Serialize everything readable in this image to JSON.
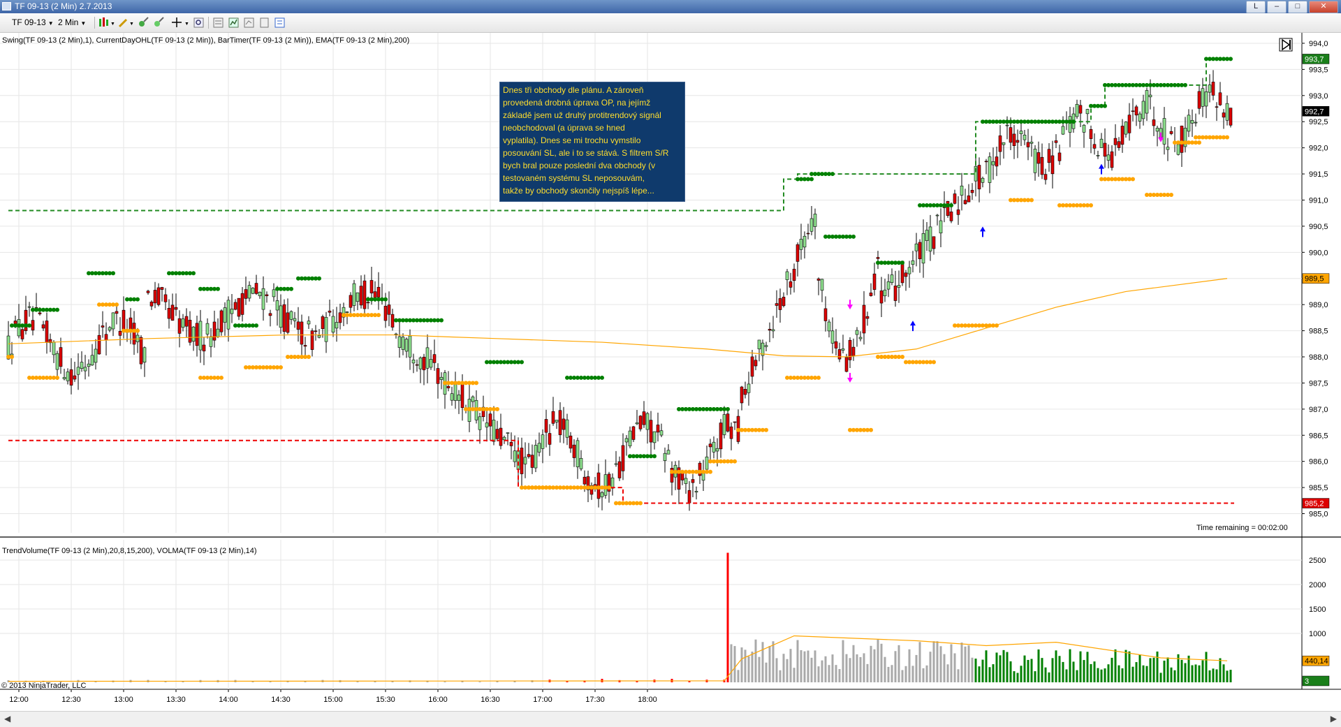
{
  "window": {
    "title": "TF 09-13 (2 Min)  2.7.2013",
    "buttons": {
      "l": "L",
      "minimize": "–",
      "maximize": "□",
      "close": "✕"
    }
  },
  "toolbar": {
    "instrument": "TF 09-13",
    "interval": "2 Min",
    "icons": [
      "bar-type-icon",
      "pencil-icon",
      "magic-icon",
      "crosshair-icon",
      "zoom-icon",
      "properties-icon",
      "indicators-icon",
      "strategy-icon",
      "data-box-icon",
      "text-icon"
    ]
  },
  "indicators_label": "Swing(TF 09-13 (2 Min),1), CurrentDayOHL(TF 09-13 (2 Min)), BarTimer(TF 09-13 (2 Min)), EMA(TF 09-13 (2 Min),200)",
  "volume_label": "TrendVolume(TF 09-13 (2 Min),20,8,15,200), VOLMA(TF 09-13 (2 Min),14)",
  "annotation_lines": [
    "Dnes tři obchody dle plánu. A zároveň",
    "provedená drobná úprava OP, na jejímž",
    "základě jsem už druhý protitrendový signál",
    "neobchodoval  (a úprava se hned",
    "vyplatila). Dnes se mi trochu vymstilo",
    "posouvání SL, ale i to se stává. S filtrem S/R",
    "bych bral pouze poslední dva obchody (v",
    "testovaném systému SL neposouvám,",
    "takže by obchody skončily nejspíš lépe..."
  ],
  "time_remaining": "Time remaining = 00:02:00",
  "copyright": "© 2013 NinjaTrader, LLC",
  "price_markers": {
    "high": "993,7",
    "last": "992,7",
    "ema": "989,5",
    "low": "985,2",
    "volma": "440,14",
    "volume_last": "3"
  },
  "colors": {
    "up_candle": "#8ee08e",
    "down_candle": "#dd0000",
    "swing_high": "#008000",
    "swing_low": "#ffa500",
    "ema": "#ffa500",
    "day_high": "#228b22",
    "day_low": "#ee0000",
    "volume_up": "#008000",
    "volume_down": "#ff0000",
    "volume_neutral": "#a9a9a9"
  },
  "chart_data": [
    {
      "type": "candlestick",
      "interval": "2 Min",
      "x_ticks": [
        "12:00",
        "12:30",
        "13:00",
        "13:30",
        "14:00",
        "14:30",
        "15:00",
        "15:30",
        "16:00",
        "16:30",
        "17:00",
        "17:30",
        "18:00"
      ],
      "y_ticks": [
        "985,0",
        "985,5",
        "986,0",
        "986,5",
        "987,0",
        "987,5",
        "988,0",
        "988,5",
        "989,0",
        "989,5",
        "990,0",
        "990,5",
        "991,0",
        "991,5",
        "992,0",
        "992,5",
        "993,0",
        "993,5",
        "994,0"
      ],
      "ylim": [
        984.9,
        994.2
      ],
      "grid": true,
      "start_time": "11:54",
      "series": [
        {
          "name": "Swing high",
          "style": "dots",
          "segments": [
            [
              1,
              6,
              988.6
            ],
            [
              7,
              14,
              988.9
            ],
            [
              23,
              30,
              989.6
            ],
            [
              34,
              37,
              989.1
            ],
            [
              46,
              53,
              989.6
            ],
            [
              55,
              60,
              989.3
            ],
            [
              65,
              71,
              988.6
            ],
            [
              77,
              81,
              989.3
            ],
            [
              83,
              89,
              989.5
            ],
            [
              103,
              108,
              989.1
            ],
            [
              111,
              124,
              988.7
            ],
            [
              137,
              147,
              987.9
            ],
            [
              160,
              170,
              987.6
            ],
            [
              178,
              185,
              986.1
            ],
            [
              192,
              206,
              987.0
            ],
            [
              226,
              230,
              991.4
            ],
            [
              230,
              236,
              991.5
            ],
            [
              234,
              242,
              990.3
            ],
            [
              249,
              256,
              989.8
            ],
            [
              261,
              270,
              990.9
            ],
            [
              279,
              286,
              992.5
            ],
            [
              286,
              305,
              992.5
            ],
            [
              310,
              314,
              992.8
            ],
            [
              314,
              337,
              993.2
            ],
            [
              343,
              350,
              993.7
            ]
          ]
        },
        {
          "name": "Swing low",
          "style": "dots",
          "segments": [
            [
              0,
              1,
              988.0
            ],
            [
              6,
              14,
              987.6
            ],
            [
              26,
              31,
              989.0
            ],
            [
              33,
              37,
              988.5
            ],
            [
              55,
              61,
              987.6
            ],
            [
              68,
              78,
              987.8
            ],
            [
              80,
              86,
              988.0
            ],
            [
              96,
              106,
              988.8
            ],
            [
              125,
              134,
              987.5
            ],
            [
              131,
              140,
              987.0
            ],
            [
              147,
              155,
              985.5
            ],
            [
              149,
              172,
              985.5
            ],
            [
              174,
              181,
              985.2
            ],
            [
              190,
              201,
              985.8
            ],
            [
              201,
              208,
              986.0
            ],
            [
              209,
              217,
              986.6
            ],
            [
              223,
              232,
              987.6
            ],
            [
              241,
              247,
              986.6
            ],
            [
              249,
              256,
              988.0
            ],
            [
              257,
              265,
              987.9
            ],
            [
              271,
              283,
              988.6
            ],
            [
              287,
              293,
              991.0
            ],
            [
              301,
              310,
              990.9
            ],
            [
              313,
              322,
              991.4
            ],
            [
              326,
              333,
              991.1
            ],
            [
              334,
              341,
              992.1
            ],
            [
              340,
              349,
              992.2
            ]
          ]
        },
        {
          "name": "Current day high",
          "style": "dashed",
          "steps": [
            [
              0,
              990.8
            ],
            [
              222,
              991.4
            ],
            [
              226,
              991.5
            ],
            [
              277,
              992.5
            ],
            [
              310,
              992.8
            ],
            [
              314,
              993.2
            ],
            [
              343,
              993.7
            ],
            [
              350,
              993.7
            ]
          ]
        },
        {
          "name": "Current day low",
          "style": "dashed",
          "steps": [
            [
              0,
              986.4
            ],
            [
              146,
              985.5
            ],
            [
              176,
              985.2
            ],
            [
              351,
              985.2
            ]
          ]
        },
        {
          "name": "EMA 200",
          "points": [
            [
              0,
              988.25
            ],
            [
              40,
              988.35
            ],
            [
              80,
              988.42
            ],
            [
              110,
              988.42
            ],
            [
              140,
              988.35
            ],
            [
              170,
              988.28
            ],
            [
              200,
              988.15
            ],
            [
              222,
              988.02
            ],
            [
              240,
              988.0
            ],
            [
              260,
              988.15
            ],
            [
              280,
              988.55
            ],
            [
              300,
              988.95
            ],
            [
              320,
              989.25
            ],
            [
              349,
              989.5
            ]
          ]
        }
      ]
    },
    {
      "type": "bar",
      "name": "Volume",
      "yticks": [
        "1000",
        "1500",
        "2000",
        "2500"
      ],
      "ylim": [
        0,
        2700
      ],
      "segments": [
        {
          "from": 0,
          "to": 154,
          "level": 40,
          "state": "neutral"
        },
        {
          "from": 155,
          "to": 205,
          "level": 60,
          "state": "down"
        },
        {
          "from": 206,
          "to": 276,
          "level": 700,
          "state": "neutral"
        },
        {
          "from": 277,
          "to": 350,
          "level": 550,
          "state": "up"
        }
      ],
      "spike": {
        "bar": 206,
        "value": 2650
      },
      "volma": [
        [
          0,
          20
        ],
        [
          205,
          30
        ],
        [
          210,
          480
        ],
        [
          225,
          950
        ],
        [
          260,
          850
        ],
        [
          280,
          750
        ],
        [
          300,
          820
        ],
        [
          330,
          500
        ],
        [
          349,
          440
        ]
      ]
    }
  ]
}
